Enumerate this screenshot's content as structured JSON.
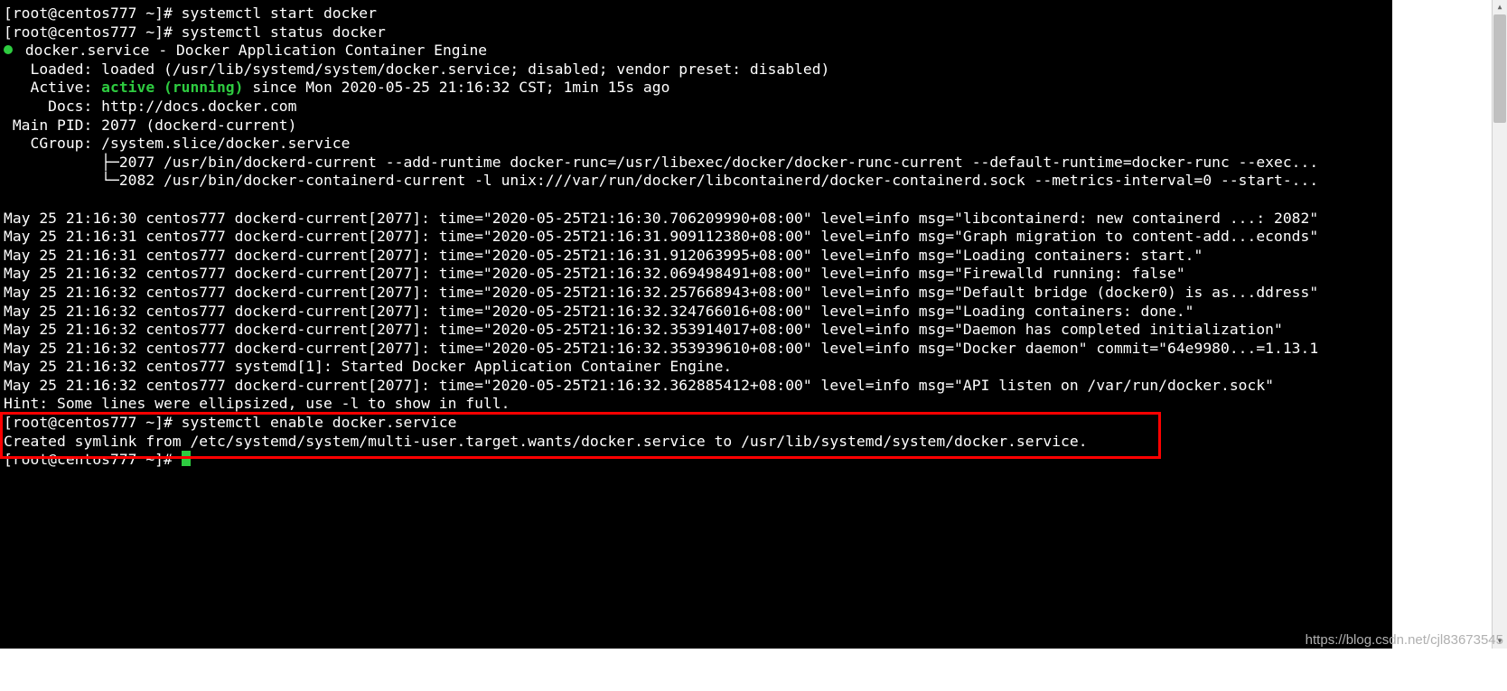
{
  "prompt": "[root@centos777 ~]#",
  "cmd_start": "systemctl start docker",
  "cmd_status": "systemctl status docker",
  "cmd_enable": "systemctl enable docker.service",
  "bullet_line": " docker.service - Docker Application Container Engine",
  "loaded_line": "   Loaded: loaded (/usr/lib/systemd/system/docker.service; disabled; vendor preset: disabled)",
  "active_prefix": "   Active: ",
  "active_status": "active (running)",
  "active_suffix": " since Mon 2020-05-25 21:16:32 CST; 1min 15s ago",
  "docs_line": "     Docs: http://docs.docker.com",
  "mainpid_line": " Main PID: 2077 (dockerd-current)",
  "cgroup_line": "   CGroup: /system.slice/docker.service",
  "tree1": "           ├─2077 /usr/bin/dockerd-current --add-runtime docker-runc=/usr/libexec/docker/docker-runc-current --default-runtime=docker-runc --exec...",
  "tree2": "           └─2082 /usr/bin/docker-containerd-current -l unix:///var/run/docker/libcontainerd/docker-containerd.sock --metrics-interval=0 --start-...",
  "log1": "May 25 21:16:30 centos777 dockerd-current[2077]: time=\"2020-05-25T21:16:30.706209990+08:00\" level=info msg=\"libcontainerd: new containerd ...: 2082\"",
  "log2": "May 25 21:16:31 centos777 dockerd-current[2077]: time=\"2020-05-25T21:16:31.909112380+08:00\" level=info msg=\"Graph migration to content-add...econds\"",
  "log3": "May 25 21:16:31 centos777 dockerd-current[2077]: time=\"2020-05-25T21:16:31.912063995+08:00\" level=info msg=\"Loading containers: start.\"",
  "log4": "May 25 21:16:32 centos777 dockerd-current[2077]: time=\"2020-05-25T21:16:32.069498491+08:00\" level=info msg=\"Firewalld running: false\"",
  "log5": "May 25 21:16:32 centos777 dockerd-current[2077]: time=\"2020-05-25T21:16:32.257668943+08:00\" level=info msg=\"Default bridge (docker0) is as...ddress\"",
  "log6": "May 25 21:16:32 centos777 dockerd-current[2077]: time=\"2020-05-25T21:16:32.324766016+08:00\" level=info msg=\"Loading containers: done.\"",
  "log7": "May 25 21:16:32 centos777 dockerd-current[2077]: time=\"2020-05-25T21:16:32.353914017+08:00\" level=info msg=\"Daemon has completed initialization\"",
  "log8": "May 25 21:16:32 centos777 dockerd-current[2077]: time=\"2020-05-25T21:16:32.353939610+08:00\" level=info msg=\"Docker daemon\" commit=\"64e9980...=1.13.1",
  "log9": "May 25 21:16:32 centos777 systemd[1]: Started Docker Application Container Engine.",
  "log10": "May 25 21:16:32 centos777 dockerd-current[2077]: time=\"2020-05-25T21:16:32.362885412+08:00\" level=info msg=\"API listen on /var/run/docker.sock\"",
  "hint_line": "Hint: Some lines were ellipsized, use -l to show in full.",
  "symlink_line": "Created symlink from /etc/systemd/system/multi-user.target.wants/docker.service to /usr/lib/systemd/system/docker.service.",
  "watermark": "https://blog.csdn.net/cjl83673545"
}
